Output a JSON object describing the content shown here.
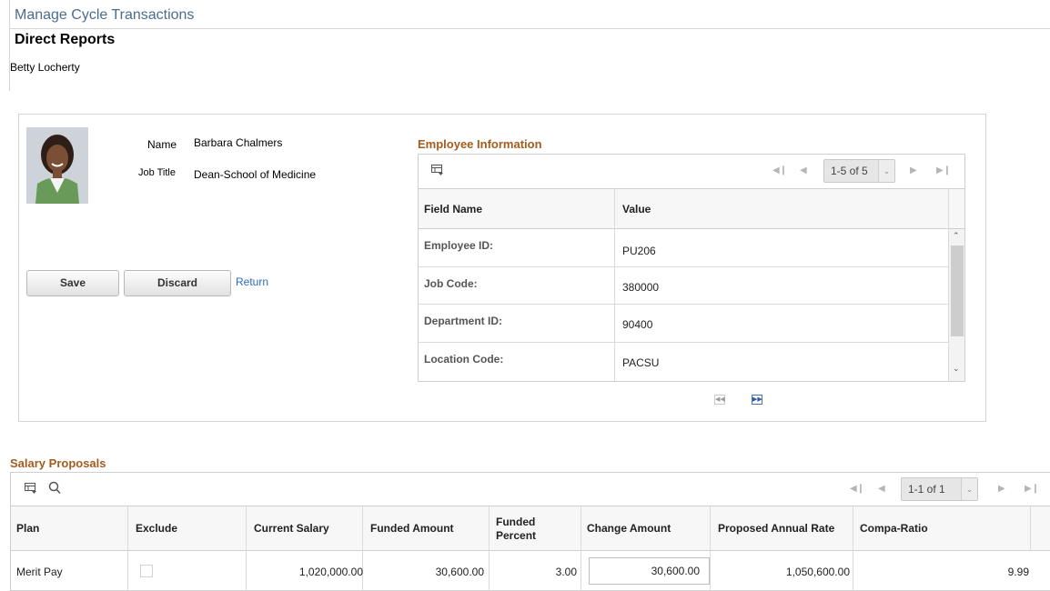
{
  "page": {
    "title": "Manage Cycle Transactions",
    "section": "Direct Reports",
    "manager": "Betty Locherty"
  },
  "employee": {
    "name_label": "Name",
    "name": "Barbara Chalmers",
    "job_title_label": "Job Title",
    "job_title": "Dean-School of Medicine"
  },
  "actions": {
    "save": "Save",
    "discard": "Discard",
    "return": "Return"
  },
  "employee_info": {
    "title": "Employee Information",
    "pager": "1-5 of 5",
    "columns": [
      "Field Name",
      "Value"
    ],
    "rows": [
      {
        "field": "Employee ID:",
        "value": "PU206"
      },
      {
        "field": "Job Code:",
        "value": "380000"
      },
      {
        "field": "Department ID:",
        "value": "90400"
      },
      {
        "field": "Location Code:",
        "value": "PACSU"
      }
    ]
  },
  "salary_proposals": {
    "title": "Salary Proposals",
    "pager": "1-1 of 1",
    "columns": [
      "Plan",
      "Exclude",
      "Current Salary",
      "Funded Amount",
      "Funded Percent",
      "Change Amount",
      "Proposed Annual Rate",
      "Compa-Ratio"
    ],
    "row": {
      "plan": "Merit Pay",
      "exclude": false,
      "current_salary": "1,020,000.00",
      "funded_amount": "30,600.00",
      "funded_percent": "3.00",
      "change_amount": "30,600.00",
      "proposed_annual_rate": "1,050,600.00",
      "compa_ratio": "9.99"
    }
  },
  "colors": {
    "page_title": "#4a6c8e",
    "group_title": "#a45c1e",
    "link": "#2a6dbb"
  }
}
